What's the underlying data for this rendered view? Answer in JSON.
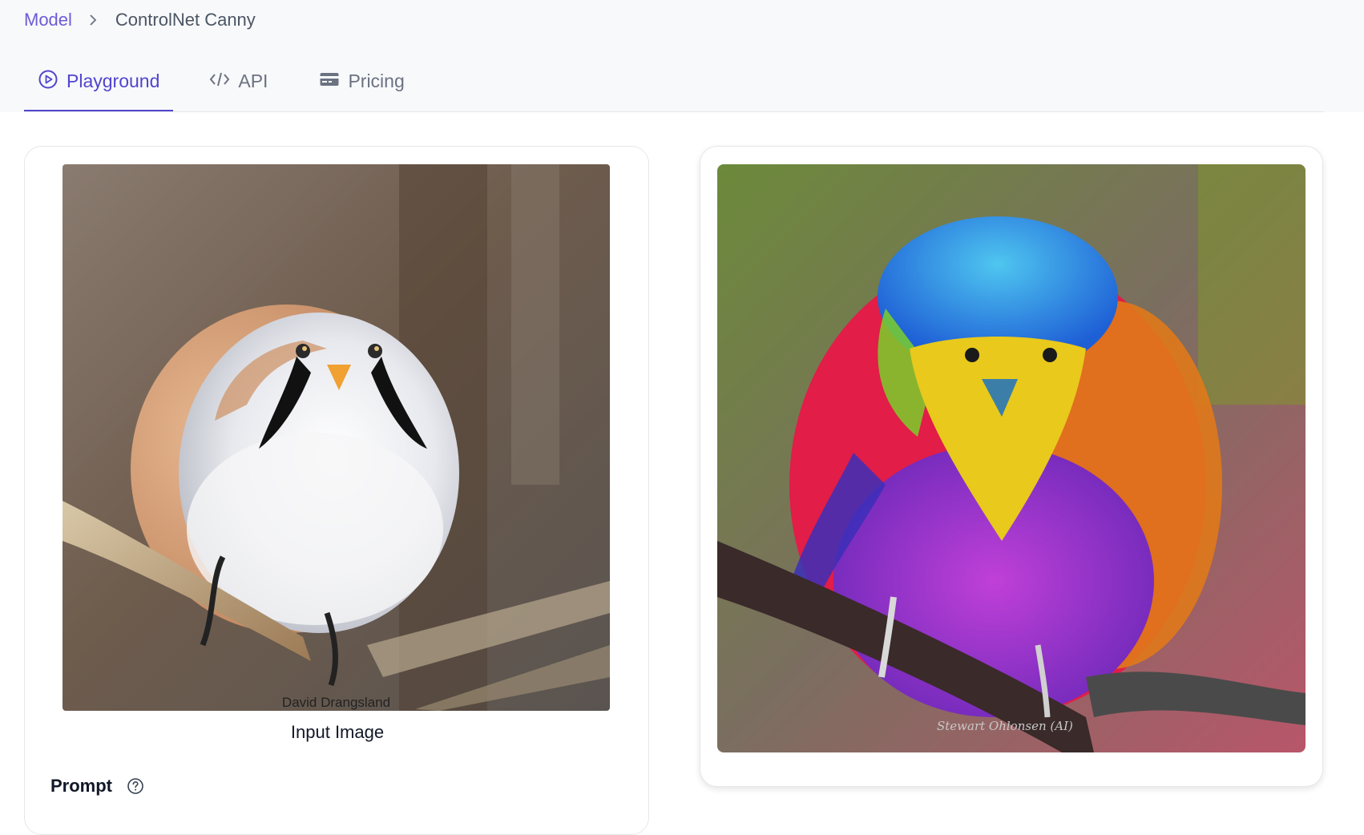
{
  "breadcrumb": {
    "root": "Model",
    "current": "ControlNet Canny"
  },
  "tabs": [
    {
      "label": "Playground",
      "icon": "play-circle-icon",
      "active": true
    },
    {
      "label": "API",
      "icon": "code-icon",
      "active": false
    },
    {
      "label": "Pricing",
      "icon": "credit-card-icon",
      "active": false
    }
  ],
  "input_panel": {
    "image_caption": "Input Image",
    "image_watermark": "David Drangsland",
    "prompt_label": "Prompt",
    "help_icon": "help-circle-icon"
  },
  "output_panel": {
    "image_watermark": "Stewart Ohlonsen (AI)"
  },
  "colors": {
    "accent": "#5145cd",
    "breadcrumb_link": "#6b5bd6",
    "header_bg": "#f8f9fb"
  }
}
